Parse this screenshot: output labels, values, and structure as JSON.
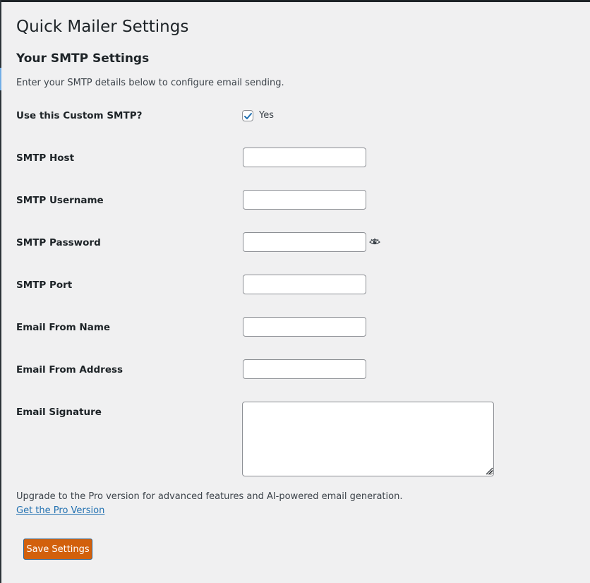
{
  "page": {
    "title": "Quick Mailer Settings",
    "section_heading": "Your SMTP Settings",
    "description": "Enter your SMTP details below to configure email sending."
  },
  "form": {
    "use_custom_smtp": {
      "label": "Use this Custom SMTP?",
      "checked": true,
      "option_label": "Yes"
    },
    "smtp_host": {
      "label": "SMTP Host",
      "value": ""
    },
    "smtp_username": {
      "label": "SMTP Username",
      "value": ""
    },
    "smtp_password": {
      "label": "SMTP Password",
      "value": "",
      "toggle_icon": "eye-icon"
    },
    "smtp_port": {
      "label": "SMTP Port",
      "value": ""
    },
    "email_from_name": {
      "label": "Email From Name",
      "value": ""
    },
    "email_from_address": {
      "label": "Email From Address",
      "value": ""
    },
    "email_signature": {
      "label": "Email Signature",
      "value": ""
    }
  },
  "footer": {
    "upgrade_text": "Upgrade to the Pro version for advanced features and AI-powered email generation.",
    "pro_link": "Get the Pro Version",
    "save_button": "Save Settings"
  },
  "colors": {
    "background": "#f0f0f1",
    "link": "#2271b1",
    "save_button": "#d2600c",
    "checkbox_check": "#2271b1"
  }
}
